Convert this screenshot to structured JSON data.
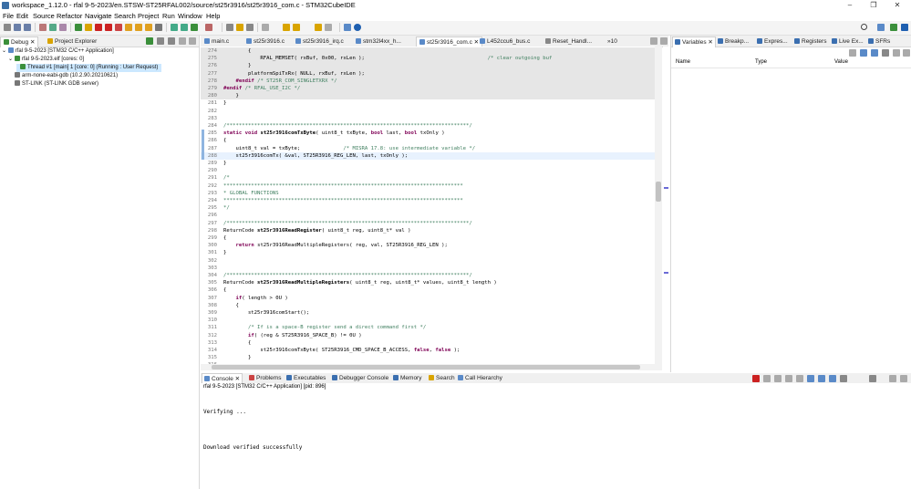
{
  "window": {
    "title": "workspace_1.12.0 - rfal 9-5-2023/en.STSW-ST25RFAL002/source/st25r3916/st25r3916_com.c - STM32CubeIDE",
    "minimize": "–",
    "maximize": "❐",
    "close": "✕"
  },
  "menu": [
    "File",
    "Edit",
    "Source",
    "Refactor",
    "Navigate",
    "Search",
    "Project",
    "Run",
    "Window",
    "Help"
  ],
  "left_tabs": {
    "debug": "Debug",
    "project_explorer": "Project Explorer"
  },
  "debug_tree": [
    {
      "label": "rfal 9-5-2023 [STM32 C/C++ Application]",
      "indent": 0
    },
    {
      "label": "rfal 9-5-2023.elf [cores: 0]",
      "indent": 1
    },
    {
      "label": "Thread #1 [main] 1 [core: 0] (Running : User Request)",
      "indent": 2,
      "selected": true
    },
    {
      "label": "arm-none-eabi-gdb (10.2.90.20210621)",
      "indent": 1
    },
    {
      "label": "ST-LINK (ST-LINK GDB server)",
      "indent": 1
    }
  ],
  "editor_tabs": [
    "main.c",
    "st25r3916.c",
    "st25r3916_irq.c",
    "stm32l4xx_h...",
    "st25r3916_com.c",
    "L452ccu6_bus.c",
    "Reset_Handl...",
    "»10"
  ],
  "active_editor_tab": "st25r3916_com.c",
  "code_lines": [
    {
      "n": "274",
      "t": "        {",
      "s": "hl"
    },
    {
      "n": "275",
      "t": "            RFAL_MEMSET( rxBuf, 0x00, rxLen );                                        /* clear outgoing buf",
      "s": "hl"
    },
    {
      "n": "276",
      "t": "        }",
      "s": "hl"
    },
    {
      "n": "277",
      "t": "        platformSpiTxRx( NULL, rxBuf, rxLen );",
      "s": "hl"
    },
    {
      "n": "278",
      "t": "    #endif /* ST25R_COM_SINGLETXRX */",
      "s": "hl"
    },
    {
      "n": "279",
      "t": "#endif /* RFAL_USE_I2C */",
      "s": "hl"
    },
    {
      "n": "280",
      "t": "    }",
      "s": "hl"
    },
    {
      "n": "281",
      "t": "}",
      "s": ""
    },
    {
      "n": "282",
      "t": "",
      "s": ""
    },
    {
      "n": "283",
      "t": "",
      "s": ""
    },
    {
      "n": "284",
      "t": "/*******************************************************************************/",
      "s": ""
    },
    {
      "n": "285",
      "t": "static void st25r3916comTxByte( uint8_t txByte, bool last, bool txOnly )",
      "s": ""
    },
    {
      "n": "286",
      "t": "{",
      "s": ""
    },
    {
      "n": "287",
      "t": "    uint8_t val = txByte;              /* MISRA 17.8: use intermediate variable */",
      "s": ""
    },
    {
      "n": "288",
      "t": "    st25r3916comTx( &val, ST25R3916_REG_LEN, last, txOnly );",
      "s": "cur"
    },
    {
      "n": "289",
      "t": "}",
      "s": ""
    },
    {
      "n": "290",
      "t": "",
      "s": ""
    },
    {
      "n": "291",
      "t": "/*",
      "s": ""
    },
    {
      "n": "292",
      "t": "******************************************************************************",
      "s": ""
    },
    {
      "n": "293",
      "t": "* GLOBAL FUNCTIONS",
      "s": ""
    },
    {
      "n": "294",
      "t": "******************************************************************************",
      "s": ""
    },
    {
      "n": "295",
      "t": "*/",
      "s": ""
    },
    {
      "n": "296",
      "t": "",
      "s": ""
    },
    {
      "n": "297",
      "t": "/*******************************************************************************/",
      "s": ""
    },
    {
      "n": "298",
      "t": "ReturnCode st25r3916ReadRegister( uint8_t reg, uint8_t* val )",
      "s": ""
    },
    {
      "n": "299",
      "t": "{",
      "s": ""
    },
    {
      "n": "300",
      "t": "    return st25r3916ReadMultipleRegisters( reg, val, ST25R3916_REG_LEN );",
      "s": ""
    },
    {
      "n": "301",
      "t": "}",
      "s": ""
    },
    {
      "n": "302",
      "t": "",
      "s": ""
    },
    {
      "n": "303",
      "t": "",
      "s": ""
    },
    {
      "n": "304",
      "t": "/*******************************************************************************/",
      "s": ""
    },
    {
      "n": "305",
      "t": "ReturnCode st25r3916ReadMultipleRegisters( uint8_t reg, uint8_t* values, uint8_t length )",
      "s": ""
    },
    {
      "n": "306",
      "t": "{",
      "s": ""
    },
    {
      "n": "307",
      "t": "    if( length > 0U )",
      "s": ""
    },
    {
      "n": "308",
      "t": "    {",
      "s": ""
    },
    {
      "n": "309",
      "t": "        st25r3916comStart();",
      "s": ""
    },
    {
      "n": "310",
      "t": "",
      "s": ""
    },
    {
      "n": "311",
      "t": "        /* If is a space-B register send a direct command first */",
      "s": ""
    },
    {
      "n": "312",
      "t": "        if( (reg & ST25R3916_SPACE_B) != 0U )",
      "s": ""
    },
    {
      "n": "313",
      "t": "        {",
      "s": ""
    },
    {
      "n": "314",
      "t": "            st25r3916comTxByte( ST25R3916_CMD_SPACE_B_ACCESS, false, false );",
      "s": ""
    },
    {
      "n": "315",
      "t": "        }",
      "s": ""
    },
    {
      "n": "316",
      "t": "",
      "s": ""
    },
    {
      "n": "317",
      "t": "        st25r3916comTxByte( ((reg & ~ST25R3916_SPACE_B) | ST25R3916_READ_MODE), true, false );",
      "s": ""
    }
  ],
  "right_tabs": [
    "Variables",
    "Breakp...",
    "Expres...",
    "Registers",
    "Live Ex...",
    "SFRs"
  ],
  "variables_columns": {
    "name": "Name",
    "type": "Type",
    "value": "Value"
  },
  "console_tabs": [
    "Console",
    "Problems",
    "Executables",
    "Debugger Console",
    "Memory",
    "Search",
    "Call Hierarchy"
  ],
  "console_title": "rfal 9-5-2023 [STM32 C/C++ Application] [pid: 896]",
  "console_lines": {
    "verifying": "Verifying ...",
    "download": "Download verified successfully"
  },
  "colors": {
    "accent": "#3a6ea5",
    "selection": "#cce8ff",
    "highlight_row": "#e6e6e6",
    "current_line": "#e8f2fe",
    "comment": "#3f7f5f",
    "keyword": "#7f0055"
  }
}
